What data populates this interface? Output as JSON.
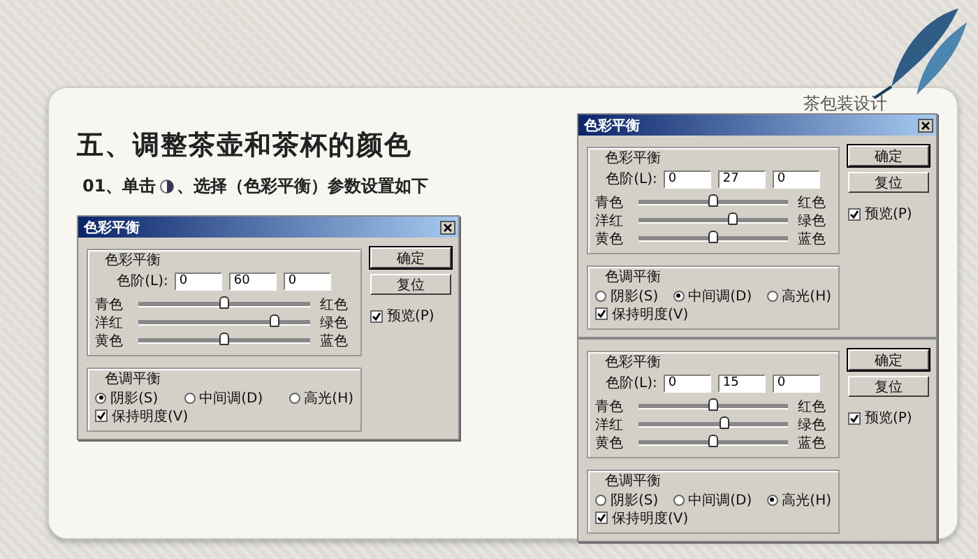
{
  "heading": "五、调整茶壶和茶杯的颜色",
  "instruction": {
    "before": "01、单击",
    "after": "、选择（色彩平衡）参数设置如下"
  },
  "corner_title": "茶包装设计",
  "dialogs": [
    {
      "title": "色彩平衡",
      "group_title": "色彩平衡",
      "levels_label": "色阶(L):",
      "values": [
        "0",
        "60",
        "0"
      ],
      "sliders": [
        {
          "left": "青色",
          "right": "红色",
          "level": 0.5
        },
        {
          "left": "洋红",
          "right": "绿色",
          "level": 0.8
        },
        {
          "left": "黄色",
          "right": "蓝色",
          "level": 0.5
        }
      ],
      "tone_title": "色调平衡",
      "tones": [
        {
          "label": "阴影(S)",
          "selected": true
        },
        {
          "label": "中间调(D)",
          "selected": false
        },
        {
          "label": "高光(H)",
          "selected": false
        }
      ],
      "preserve": {
        "label": "保持明度(V)",
        "checked": true
      },
      "buttons": [
        "确定",
        "复位"
      ],
      "preview": {
        "label": "预览(P)",
        "checked": true
      }
    },
    {
      "title": "色彩平衡",
      "group_title": "色彩平衡",
      "levels_label": "色阶(L):",
      "values": [
        "0",
        "27",
        "0"
      ],
      "sliders": [
        {
          "left": "青色",
          "right": "红色",
          "level": 0.5
        },
        {
          "left": "洋红",
          "right": "绿色",
          "level": 0.635
        },
        {
          "left": "黄色",
          "right": "蓝色",
          "level": 0.5
        }
      ],
      "tone_title": "色调平衡",
      "tones": [
        {
          "label": "阴影(S)",
          "selected": false
        },
        {
          "label": "中间调(D)",
          "selected": true
        },
        {
          "label": "高光(H)",
          "selected": false
        }
      ],
      "preserve": {
        "label": "保持明度(V)",
        "checked": true
      },
      "buttons": [
        "确定",
        "复位"
      ],
      "preview": {
        "label": "预览(P)",
        "checked": true
      }
    },
    {
      "group_title": "色彩平衡",
      "levels_label": "色阶(L):",
      "values": [
        "0",
        "15",
        "0"
      ],
      "sliders": [
        {
          "left": "青色",
          "right": "红色",
          "level": 0.5
        },
        {
          "left": "洋红",
          "right": "绿色",
          "level": 0.575
        },
        {
          "left": "黄色",
          "right": "蓝色",
          "level": 0.5
        }
      ],
      "tone_title": "色调平衡",
      "tones": [
        {
          "label": "阴影(S)",
          "selected": false
        },
        {
          "label": "中间调(D)",
          "selected": false
        },
        {
          "label": "高光(H)",
          "selected": true
        }
      ],
      "preserve": {
        "label": "保持明度(V)",
        "checked": true
      },
      "buttons": [
        "确定",
        "复位"
      ],
      "preview": {
        "label": "预览(P)",
        "checked": true
      }
    }
  ]
}
